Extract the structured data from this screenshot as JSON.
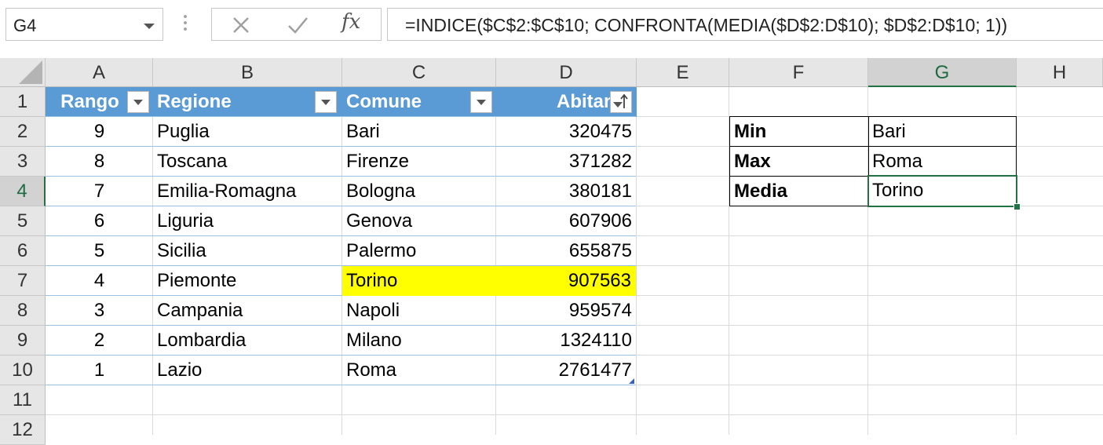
{
  "formula_bar": {
    "name_box": "G4",
    "formula": "=INDICE($C$2:$C$10; CONFRONTA(MEDIA($D$2:D$10); $D$2:D$10; 1))",
    "cancel_icon": "close-icon",
    "enter_icon": "check-icon",
    "function_label": "fx"
  },
  "columns": [
    "A",
    "B",
    "C",
    "D",
    "E",
    "F",
    "G",
    "H"
  ],
  "rows": [
    "1",
    "2",
    "3",
    "4",
    "5",
    "6",
    "7",
    "8",
    "9",
    "10",
    "11",
    "12"
  ],
  "table": {
    "headers": [
      "Rango",
      "Regione",
      "Comune",
      "Abitanti"
    ],
    "rows": [
      [
        "9",
        "Puglia",
        "Bari",
        "320475"
      ],
      [
        "8",
        "Toscana",
        "Firenze",
        "371282"
      ],
      [
        "7",
        "Emilia-Romagna",
        "Bologna",
        "380181"
      ],
      [
        "6",
        "Liguria",
        "Genova",
        "607906"
      ],
      [
        "5",
        "Sicilia",
        "Palermo",
        "655875"
      ],
      [
        "4",
        "Piemonte",
        "Torino",
        "907563"
      ],
      [
        "3",
        "Campania",
        "Napoli",
        "959574"
      ],
      [
        "2",
        "Lombardia",
        "Milano",
        "1324110"
      ],
      [
        "1",
        "Lazio",
        "Roma",
        "2761477"
      ]
    ]
  },
  "summary": [
    {
      "label": "Min",
      "value": "Bari"
    },
    {
      "label": "Max",
      "value": "Roma"
    },
    {
      "label": "Media",
      "value": "Torino"
    }
  ],
  "colors": {
    "header_fill": "#5b9bd5",
    "highlight": "#ffff00",
    "selection": "#217346"
  }
}
